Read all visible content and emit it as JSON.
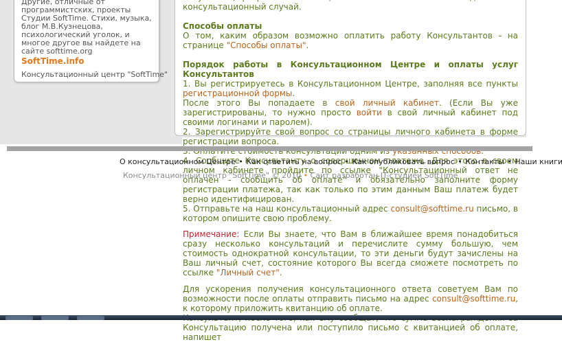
{
  "sidebar": {
    "description": "Другие, отличные от программистских, проекты Студии SoftTime. Стихи, музыка, блог М.В.Кузнецова, психологический уголок, и многое другое вы найдете на сайте softtime.org",
    "link_title": "SoftTime.info",
    "link_subtitle": "Консультационный центр \"SoftTime\""
  },
  "content": {
    "intro_text": "Безусловно, разработка полноценного Web-сайта это тоже далеко не консультационный случай.",
    "payment_heading": "Способы оплаты",
    "payment_text": "О том, каким образом возможно оплатить работу Консультантов - на странице ",
    "payment_link": "\"Способы оплаты\"",
    "order_heading": "Порядок работы в Консультационном Центре и оплаты услуг Консультантов",
    "step1_text": "1. Вы регистрируетесь в Консультационном Центре, заполняя все пункты ",
    "step1_link": "регистрационной формы",
    "step1b_text_a": "После этого Вы попадаете в ",
    "step1b_link_a": "свой личный кабинет",
    "step1b_text_b": ". (Если Вы уже зарегистрированы, то нужно просто ",
    "step1b_link_b": "войти",
    "step1b_text_c": " в свой личный кабинет под своими логинами и паролем).",
    "step2_text": "2. Зарегистрируйте свой вопрос со страницы личного кабинета в форме регистрации вопроса.",
    "step3_text": "3. Оплатите стоимость консультации одним из ",
    "step3_link": "указанных способов",
    "step4_text_a": "4. Сообщите Консультанту о совершенном платеже.",
    "step4_link": "",
    "step4_text_b": " Для этого в своем личном кабинете пройдите по ссылке \"Консультационный ответ не оплачен - сообщить об оплате\" и обязательно заполните форму регистрации платежа, так как только по этим данным Ваш платеж будет верно идентифицирован.",
    "step5_text": "5. Отправьте на наш консультационный адрес ",
    "step5_link": "consult@softtime.ru",
    "step5_text_b": " письмо, в котором опишите свою проблему.",
    "note_label": "Примечание:",
    "note_text": " Если Вы знаете, что Вам в ближайшее время понадобиться сразу несколько консультаций и перечислите сумму большую, чем стоимость однократной консультации, то эти деньги будут зачислены на Ваш личный счет, состояние которого Вы всегда сможете посмотреть по ссылке ",
    "note_link": "\"Личный счет\"",
    "speed_text": "Для ускорения получения консультационного ответа советуем Вам по возможности после оплаты отправить письмо на адрес ",
    "speed_link": "consult@softtime.ru",
    "speed_text_b": ", к которому приложить квитанцию об оплате.",
    "final_text": "Консультант, после того, как ему сообщат, что сумма вознаграждения за Консультацию получена или поступило письмо с квитанцией об оплате, напишет"
  },
  "footer": {
    "nav": [
      "О консультационном Центре",
      "Как ответить на вопрос",
      "Как опубликовать вопрос",
      "Контакты",
      "Наши книги"
    ],
    "separator": "•",
    "copyright_a": "Консультационный центр \"SoftTime\" © 2010",
    "copyright_bullet": "•",
    "copyright_b": "Сайт разработан IT-студией SoftTime"
  }
}
